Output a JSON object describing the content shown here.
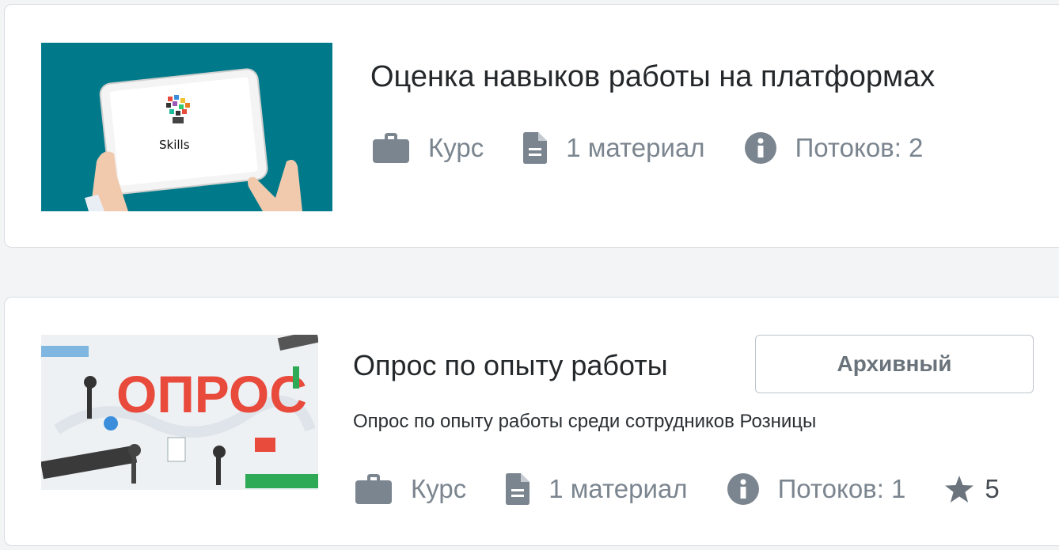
{
  "courses": [
    {
      "title": "Оценка навыков работы на платформах",
      "image_text": "Skills",
      "meta": {
        "type": "Курс",
        "materials": "1 материал",
        "streams": "Потоков: 2"
      }
    },
    {
      "title": "Опрос по опыту работы",
      "status_button": "Архивный",
      "description": "Опрос по опыту работы среди сотрудников Розницы",
      "image_text": "ОПРОС",
      "meta": {
        "type": "Курс",
        "materials": "1 материал",
        "streams": "Потоков: 1",
        "rating": "5"
      }
    }
  ],
  "icons": [
    "briefcase-icon",
    "document-icon",
    "info-icon",
    "star-icon"
  ],
  "colors": {
    "card_bg": "#ffffff",
    "page_bg": "#f3f4f6",
    "meta_gray": "#7b858f",
    "thumb_teal": "#007a8a",
    "opros_red": "#e84a3c"
  }
}
